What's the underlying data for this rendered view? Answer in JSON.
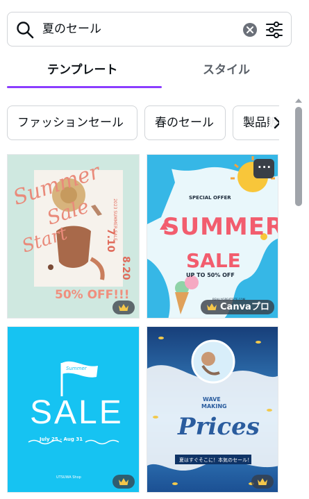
{
  "search": {
    "query": "夏のセール"
  },
  "tabs": [
    {
      "label": "テンプレート",
      "active": true
    },
    {
      "label": "スタイル",
      "active": false
    }
  ],
  "chips": [
    "ファッションセール",
    "春のセール",
    "製品販"
  ],
  "colors": {
    "accent": "#8b3dff",
    "border": "#d1d4d8",
    "text": "#0e1318"
  },
  "results": [
    {
      "theme": "summer-sale-fashion",
      "lines": [
        "Summer",
        "Sale",
        "Start",
        "7.10",
        "8.20",
        "50% OFF!!!",
        "2023 SUMMER SALE"
      ],
      "badge": "crown-icon"
    },
    {
      "theme": "summer-sale-sun",
      "lines": [
        "SPECIAL OFFER",
        "SUMMER",
        "SALE",
        "UP TO 50% OFF",
        "REALLYGREATSITE.COM"
      ],
      "badge": "Canvaプロ",
      "more_label": "···"
    },
    {
      "theme": "summer-sale-flag",
      "lines": [
        "Summer",
        "SALE",
        "July 25 - Aug 31",
        "UTSUWA Shop"
      ],
      "badge": "crown-icon"
    },
    {
      "theme": "wave-making-prices",
      "lines": [
        "WAVE",
        "MAKING",
        "Prices",
        "夏はすぐそこに！本気のセール！"
      ],
      "badge": "crown-icon"
    }
  ]
}
